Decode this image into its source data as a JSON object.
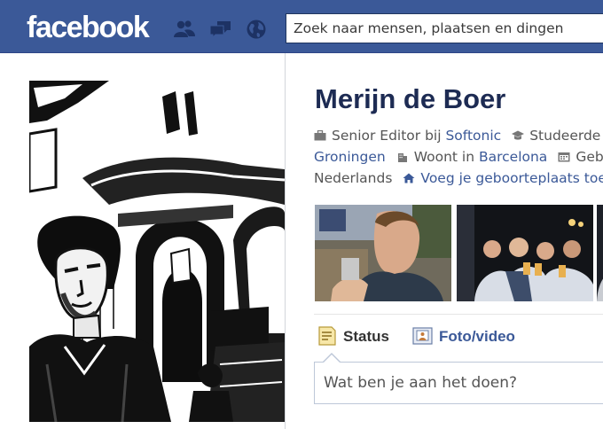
{
  "header": {
    "logo_text": "facebook",
    "search_placeholder": "Zoek naar mensen, plaatsen en dingen",
    "icons": [
      "friend-requests-icon",
      "messages-icon",
      "notifications-globe-icon"
    ],
    "bar_color": "#3b5998"
  },
  "profile": {
    "name": "Merijn de Boer",
    "work_prefix": "Senior Editor bij ",
    "work_company": "Softonic",
    "study_prefix": "Studeerde",
    "study_place": "Groningen",
    "lives_prefix": "Woont in ",
    "lives_city": "Barcelona",
    "birth_prefix": "Geb",
    "language": "Nederlands",
    "add_hometown": "Voeg je geboorteplaats toe"
  },
  "composer": {
    "tab_status": "Status",
    "tab_photo": "Foto/video",
    "placeholder": "Wat ben je aan het doen?"
  },
  "colors": {
    "link": "#3b5998",
    "name": "#1d2b53"
  }
}
